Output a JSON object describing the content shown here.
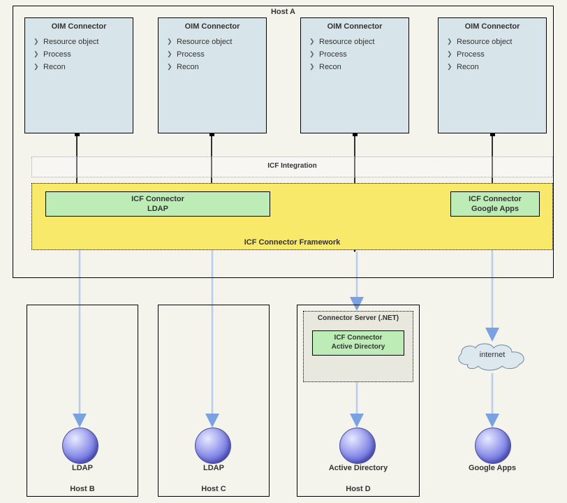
{
  "hostA": {
    "label": "Host A",
    "connectors": [
      {
        "title": "OIM Connector",
        "items": [
          "Resource object",
          "Process",
          "Recon"
        ]
      },
      {
        "title": "OIM Connector",
        "items": [
          "Resource object",
          "Process",
          "Recon"
        ]
      },
      {
        "title": "OIM Connector",
        "items": [
          "Resource object",
          "Process",
          "Recon"
        ]
      },
      {
        "title": "OIM Connector",
        "items": [
          "Resource object",
          "Process",
          "Recon"
        ]
      }
    ],
    "icfIntegrationLabel": "ICF Integration",
    "icfFrameworkLabel": "ICF Connector Framework",
    "icfLdap": {
      "line1": "ICF Connector",
      "line2": "LDAP"
    },
    "icfGoogle": {
      "line1": "ICF Connector",
      "line2": "Google Apps"
    }
  },
  "connServer": {
    "label": "Connector Server (.NET)",
    "icfAd": {
      "line1": "ICF Connector",
      "line2": "Active Directory"
    }
  },
  "cloud": {
    "label": "internet"
  },
  "targets": {
    "b": {
      "sphereLabel": "LDAP",
      "hostLabel": "Host B"
    },
    "c": {
      "sphereLabel": "LDAP",
      "hostLabel": "Host C"
    },
    "d": {
      "sphereLabel": "Active Directory",
      "hostLabel": "Host D"
    },
    "g": {
      "sphereLabel": "Google Apps"
    }
  },
  "colors": {
    "oimBox": "#d7e4ea",
    "icfBox": "#bdecb6",
    "framework": "#f9e96a",
    "canvasBg": "#f4f3ec"
  }
}
